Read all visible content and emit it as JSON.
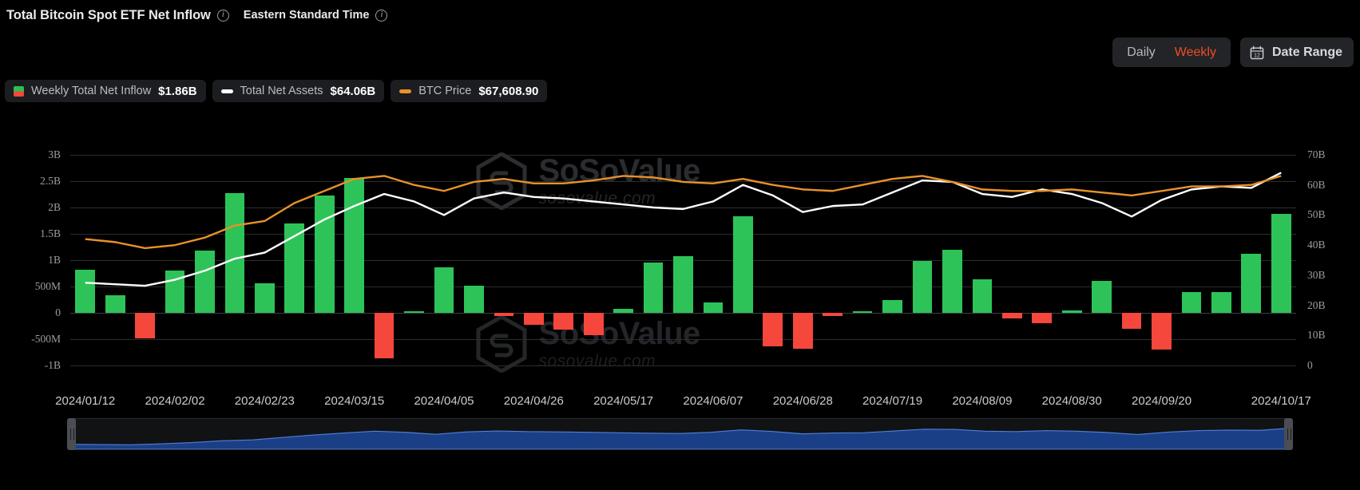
{
  "header": {
    "title": "Total Bitcoin Spot ETF Net Inflow",
    "timezone": "Eastern Standard Time",
    "title_info_icon": "info-icon",
    "tz_info_icon": "info-icon"
  },
  "toolbar": {
    "daily_label": "Daily",
    "weekly_label": "Weekly",
    "active_period": "Weekly",
    "date_range_label": "Date Range",
    "calendar_icon": "calendar-icon",
    "calendar_day": "12",
    "accent_color": "#f04c25"
  },
  "legend": [
    {
      "name": "Weekly Total Net Inflow",
      "value": "$1.86B",
      "marker": "bar-swatch",
      "color_up": "#2ec358",
      "color_down": "#f5473c"
    },
    {
      "name": "Total Net Assets",
      "value": "$64.06B",
      "marker": "line-swatch",
      "color": "#ffffff"
    },
    {
      "name": "BTC Price",
      "value": "$67,608.90",
      "marker": "line-swatch",
      "color": "#e8922a"
    }
  ],
  "watermark": {
    "brand": "SoSoValue",
    "domain": "sosovalue.com",
    "logo_icon": "sosovalue-logo-icon"
  },
  "slider": {
    "left_handle": "range-slider-left-handle",
    "right_handle": "range-slider-right-handle"
  },
  "chart_data": {
    "type": "bar",
    "title": "Total Bitcoin Spot ETF Net Inflow",
    "subtitle": "Eastern Standard Time",
    "xlabel": "",
    "ylabel": "Weekly Total Net Inflow",
    "y2label": "Total Net Assets / BTC Price",
    "grid": true,
    "legend_position": "top-left",
    "ylim": [
      -1000000000,
      3000000000
    ],
    "y2lim": [
      0,
      70000000000
    ],
    "ytick_labels": [
      "3B",
      "2.5B",
      "2B",
      "1.5B",
      "1B",
      "500M",
      "0",
      "-500M",
      "-1B"
    ],
    "ytick_values": [
      3000000000,
      2500000000,
      2000000000,
      1500000000,
      1000000000,
      500000000,
      0,
      -500000000,
      -1000000000
    ],
    "y2tick_labels": [
      "70B",
      "60B",
      "50B",
      "40B",
      "30B",
      "20B",
      "10B",
      "0"
    ],
    "y2tick_values": [
      70000000000,
      60000000000,
      50000000000,
      40000000000,
      30000000000,
      20000000000,
      10000000000,
      0
    ],
    "xtick_labels": [
      "2024/01/12",
      "2024/02/02",
      "2024/02/23",
      "2024/03/15",
      "2024/04/05",
      "2024/04/26",
      "2024/05/17",
      "2024/06/07",
      "2024/06/28",
      "2024/07/19",
      "2024/08/09",
      "2024/08/30",
      "2024/09/20",
      "2024/10/17"
    ],
    "xtick_index": [
      0,
      3,
      6,
      9,
      12,
      15,
      18,
      21,
      24,
      27,
      30,
      33,
      36,
      40
    ],
    "categories": [
      "2024/01/12",
      "2024/01/19",
      "2024/01/26",
      "2024/02/02",
      "2024/02/09",
      "2024/02/16",
      "2024/02/23",
      "2024/03/01",
      "2024/03/08",
      "2024/03/15",
      "2024/03/22",
      "2024/03/29",
      "2024/04/05",
      "2024/04/12",
      "2024/04/19",
      "2024/04/26",
      "2024/05/03",
      "2024/05/10",
      "2024/05/17",
      "2024/05/24",
      "2024/05/31",
      "2024/06/07",
      "2024/06/14",
      "2024/06/21",
      "2024/06/28",
      "2024/07/05",
      "2024/07/12",
      "2024/07/19",
      "2024/07/26",
      "2024/08/02",
      "2024/08/09",
      "2024/08/16",
      "2024/08/23",
      "2024/08/30",
      "2024/09/06",
      "2024/09/13",
      "2024/09/20",
      "2024/09/27",
      "2024/10/04",
      "2024/10/11",
      "2024/10/17"
    ],
    "series": [
      {
        "name": "Weekly Total Net Inflow",
        "type": "bar",
        "axis": "left",
        "unit": "USD",
        "values": [
          820000000,
          340000000,
          -480000000,
          810000000,
          1180000000,
          2270000000,
          560000000,
          1700000000,
          2220000000,
          2560000000,
          -860000000,
          30000000,
          870000000,
          510000000,
          -60000000,
          -220000000,
          -320000000,
          -420000000,
          80000000,
          950000000,
          1080000000,
          190000000,
          1840000000,
          -640000000,
          -680000000,
          -60000000,
          30000000,
          250000000,
          980000000,
          1200000000,
          640000000,
          -110000000,
          -190000000,
          40000000,
          600000000,
          -300000000,
          -690000000,
          390000000,
          390000000,
          1120000000,
          1880000000
        ]
      },
      {
        "name": "Total Net Assets",
        "type": "line",
        "axis": "right",
        "unit": "USD",
        "color": "#ffffff",
        "values": [
          27500000000,
          27000000000,
          26500000000,
          28500000000,
          31500000000,
          35500000000,
          37500000000,
          43000000000,
          48500000000,
          53000000000,
          57000000000,
          54500000000,
          50000000000,
          55500000000,
          57500000000,
          56000000000,
          55500000000,
          54500000000,
          53500000000,
          52500000000,
          52000000000,
          54500000000,
          60000000000,
          56500000000,
          51000000000,
          53000000000,
          53500000000,
          57500000000,
          61500000000,
          61000000000,
          57000000000,
          56000000000,
          58500000000,
          57000000000,
          54000000000,
          49500000000,
          55000000000,
          58500000000,
          59500000000,
          59000000000,
          64060000000
        ]
      },
      {
        "name": "BTC Price",
        "type": "line",
        "axis": "right",
        "unit": "USD",
        "color": "#e8922a",
        "values": [
          42000000000,
          41000000000,
          39000000000,
          40000000000,
          42500000000,
          46500000000,
          48000000000,
          54000000000,
          58000000000,
          62000000000,
          63000000000,
          60000000000,
          58000000000,
          61000000000,
          62000000000,
          60500000000,
          60500000000,
          61500000000,
          63000000000,
          62500000000,
          61000000000,
          60500000000,
          62000000000,
          60000000000,
          58500000000,
          58000000000,
          60000000000,
          62000000000,
          63000000000,
          61000000000,
          58500000000,
          58000000000,
          58000000000,
          58500000000,
          57500000000,
          56500000000,
          58000000000,
          59500000000,
          59500000000,
          60000000000,
          63000000000
        ]
      }
    ]
  }
}
